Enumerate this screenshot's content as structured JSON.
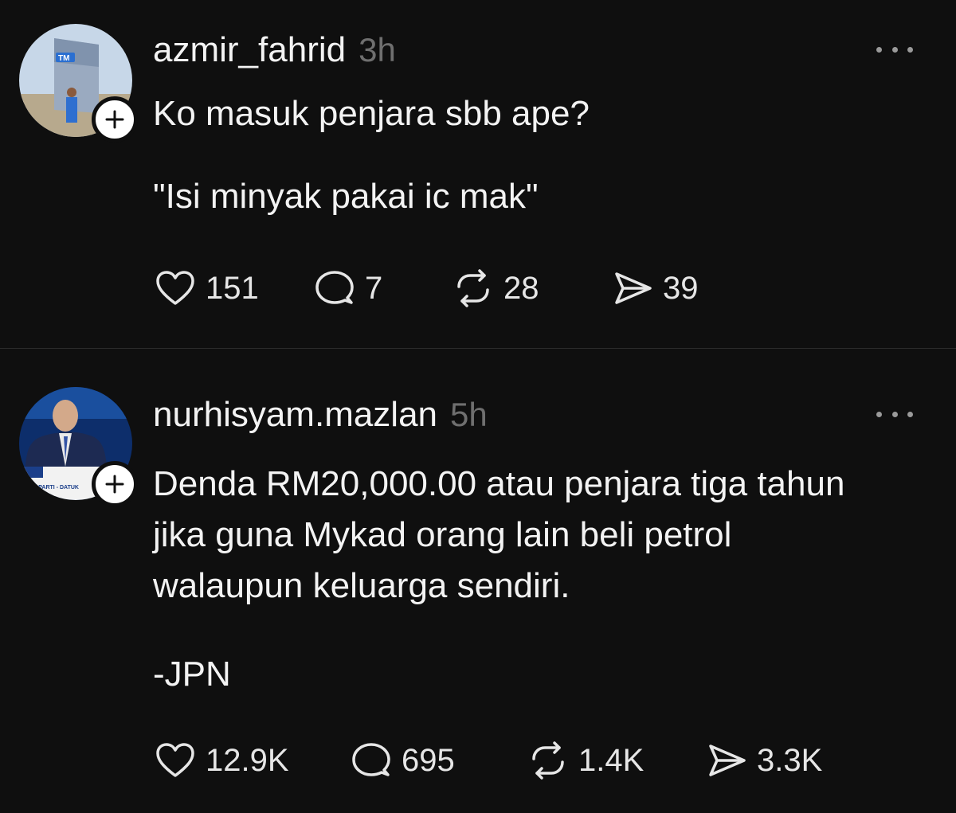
{
  "posts": [
    {
      "username": "azmir_fahrid",
      "time": "3h",
      "lines": [
        "Ko masuk penjara sbb ape?",
        "\"Isi minyak pakai ic mak\""
      ],
      "likes": "151",
      "replies": "7",
      "reposts": "28",
      "shares": "39",
      "avatar_text": "TM"
    },
    {
      "username": "nurhisyam.mazlan",
      "time": "5h",
      "lines": [
        "Denda RM20,000.00 atau penjara tiga tahun",
        "jika guna Mykad orang lain beli petrol",
        "walaupun keluarga sendiri.",
        "-JPN"
      ],
      "likes": "12.9K",
      "replies": "695",
      "reposts": "1.4K",
      "shares": "3.3K",
      "avatar_text": "WAR PARTI - DATUK"
    }
  ],
  "icons": {
    "like": "heart-icon",
    "reply": "comment-icon",
    "repost": "repost-icon",
    "share": "send-icon",
    "more": "more-icon",
    "follow": "plus-icon"
  },
  "colors": {
    "background": "#0f0f0f",
    "text": "#f3f3f3",
    "muted": "#6f6f6f"
  }
}
